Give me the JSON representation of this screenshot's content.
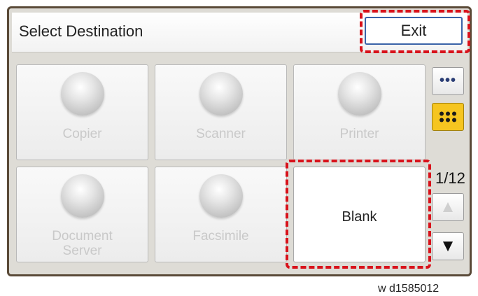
{
  "header": {
    "title": "Select Destination",
    "exit_label": "Exit"
  },
  "tiles": [
    {
      "label": "Copier",
      "state": "disabled"
    },
    {
      "label": "Scanner",
      "state": "disabled"
    },
    {
      "label": "Printer",
      "state": "disabled"
    },
    {
      "label_line1": "Document",
      "label_line2": "Server",
      "state": "disabled"
    },
    {
      "label": "Facsimile",
      "state": "disabled"
    },
    {
      "label": "Blank",
      "state": "enabled"
    }
  ],
  "side": {
    "more_label": "•••",
    "page_indicator": "1/12",
    "up_icon": "up-arrow-icon",
    "down_icon": "down-arrow-icon"
  },
  "caption": "w d1585012",
  "colors": {
    "callout": "#d8121b",
    "active_button": "#f6c520",
    "frame": "#5a4a38"
  }
}
